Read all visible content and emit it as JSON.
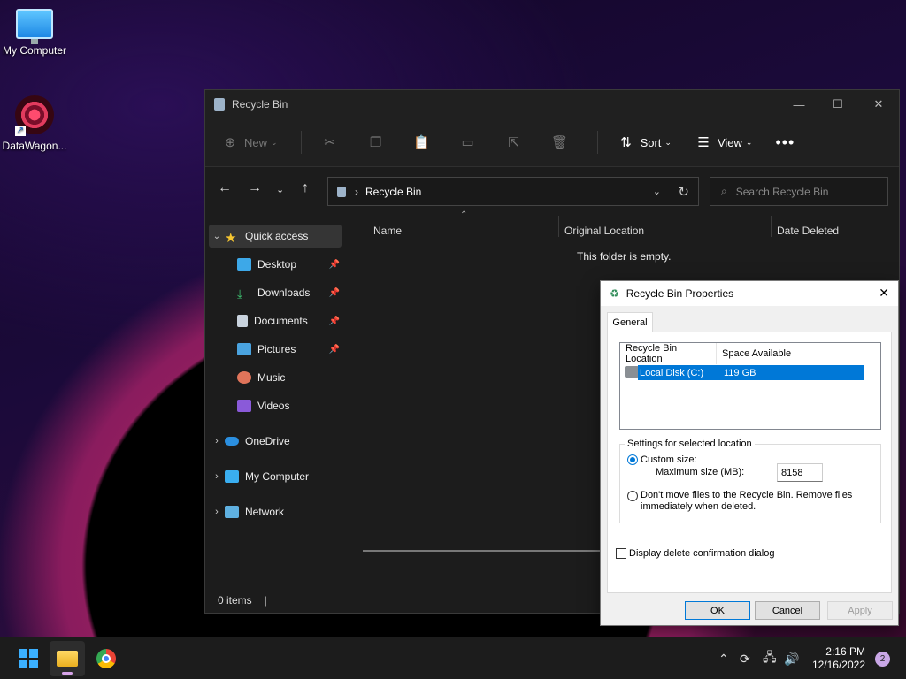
{
  "desktop": {
    "icons": [
      {
        "label": "My Computer"
      },
      {
        "label": "DataWagon..."
      }
    ]
  },
  "explorer": {
    "title": "Recycle Bin",
    "toolbar": {
      "new_label": "New",
      "sort_label": "Sort",
      "view_label": "View"
    },
    "address": {
      "crumb": "Recycle Bin"
    },
    "search": {
      "placeholder": "Search Recycle Bin"
    },
    "sidebar": {
      "quick_access": "Quick access",
      "items": [
        "Desktop",
        "Downloads",
        "Documents",
        "Pictures",
        "Music",
        "Videos"
      ],
      "onedrive": "OneDrive",
      "my_computer": "My Computer",
      "network": "Network"
    },
    "columns": {
      "name": "Name",
      "location": "Original Location",
      "deleted": "Date Deleted"
    },
    "empty_text": "This folder is empty.",
    "status": "0 items"
  },
  "dialog": {
    "title": "Recycle Bin Properties",
    "tab": "General",
    "list": {
      "col1": "Recycle Bin Location",
      "col2": "Space Available",
      "row_location": "Local Disk (C:)",
      "row_space": "119 GB"
    },
    "group_label": "Settings for selected location",
    "custom_size": "Custom size:",
    "max_size_label": "Maximum size (MB):",
    "max_size_value": "8158",
    "dont_move": "Don't move files to the Recycle Bin. Remove files",
    "dont_move_2": "immediately when deleted.",
    "confirm": "Display delete confirmation dialog",
    "ok": "OK",
    "cancel": "Cancel",
    "apply": "Apply"
  },
  "taskbar": {
    "time": "2:16 PM",
    "date": "12/16/2022",
    "notifications": "2"
  }
}
